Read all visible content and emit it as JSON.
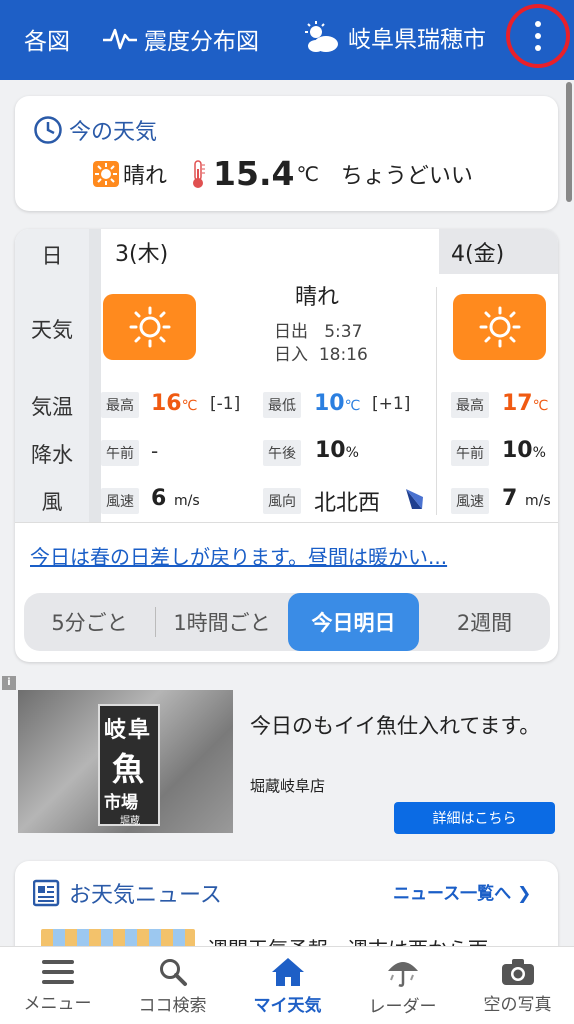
{
  "topnav": {
    "map_label": "各図",
    "quake_label": "震度分布図",
    "city_label": "岐阜県瑞穂市"
  },
  "current": {
    "title": "今の天気",
    "condition": "晴れ",
    "temp": "15.4",
    "unit": "℃",
    "comment": "ちょうどいい"
  },
  "forecast": {
    "labels": {
      "day": "日",
      "weather": "天気",
      "temp": "気温",
      "rain": "降水",
      "wind": "風"
    },
    "day1": {
      "date": "3(木)",
      "condition": "晴れ",
      "sunrise_label": "日出",
      "sunrise": "5:37",
      "sunset_label": "日入",
      "sunset": "18:16",
      "max_label": "最高",
      "max": "16",
      "max_diff": "[-1]",
      "min_label": "最低",
      "min": "10",
      "min_diff": "[+1]",
      "am_label": "午前",
      "am_rain": "-",
      "pm_label": "午後",
      "pm_rain": "10",
      "wind_speed_label": "風速",
      "wind_speed": "6",
      "wind_dir_label": "風向",
      "wind_dir": "北北西"
    },
    "day2": {
      "date": "4(金)",
      "max_label": "最高",
      "max": "17",
      "am_label": "午前",
      "am_rain": "10",
      "wind_speed_label": "風速",
      "wind_speed": "7"
    },
    "units": {
      "celsius": "℃",
      "percent": "%",
      "ms": "m/s"
    },
    "comment_link": "今日は春の日差しが戻ります。昼間は暖かい...",
    "tabs": [
      "5分ごと",
      "1時間ごと",
      "今日明日",
      "2週間"
    ],
    "active_tab": 2
  },
  "ad": {
    "info_icon": "i",
    "image_sign": [
      "岐阜",
      "魚",
      "市場",
      "堀蔵"
    ],
    "title": "今日のもイイ魚仕入れてます。",
    "shop": "堀蔵岐阜店",
    "button": "詳細はこちら"
  },
  "news": {
    "title": "お天気ニュース",
    "all_link": "ニュース一覧へ",
    "headline": "週間天気予報　週末は西から雨"
  },
  "tabbar": {
    "items": [
      "メニュー",
      "ココ検索",
      "マイ天気",
      "レーダー",
      "空の写真"
    ],
    "active": 2
  },
  "colors": {
    "brand": "#1e5fc6",
    "sun": "#ff8a1e",
    "max_temp": "#f05a12",
    "min_temp": "#2b7fe0",
    "highlight_circle": "#e8202a"
  }
}
